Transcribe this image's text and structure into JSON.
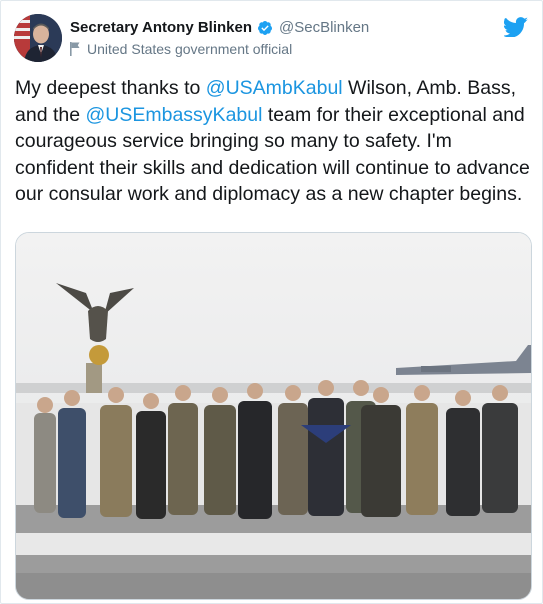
{
  "author": {
    "name": "Secretary Antony Blinken",
    "handle": "@SecBlinken",
    "label": "United States government official"
  },
  "icons": {
    "verified": "verified-badge-icon",
    "label": "government-flag-icon",
    "platform": "twitter-bird-icon"
  },
  "tweet": {
    "segments": [
      {
        "text": "My deepest thanks to ",
        "type": "text"
      },
      {
        "text": "@USAmbKabul",
        "type": "mention"
      },
      {
        "text": " Wilson, Amb. Bass, and the ",
        "type": "text"
      },
      {
        "text": "@USEmbassyKabul",
        "type": "mention"
      },
      {
        "text": " team for their exceptional and courageous service bringing so many to safety. I'm confident their skills and dedication will continue to advance our consular work and diplomacy as a new chapter begins.",
        "type": "text"
      }
    ]
  },
  "colors": {
    "accent": "#1da1f2",
    "mention": "#1b95e0",
    "text": "#14171a",
    "secondary": "#657786"
  }
}
